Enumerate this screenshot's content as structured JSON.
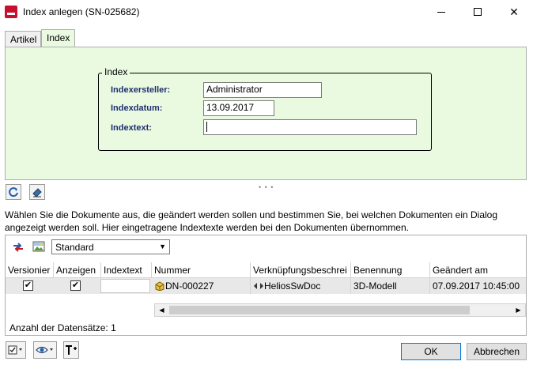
{
  "window": {
    "title": "Index anlegen (SN-025682)",
    "minimize": "—",
    "maximize": "",
    "close": "✕"
  },
  "tabs": [
    {
      "label": "Artikel",
      "active": false
    },
    {
      "label": "Index",
      "active": true
    }
  ],
  "index_group": {
    "legend": "Index",
    "creator_label": "Indexersteller:",
    "creator_value": "Administrator",
    "date_label": "Indexdatum:",
    "date_value": "13.09.2017",
    "text_label": "Indextext:",
    "text_value": ""
  },
  "splitter": "• • •",
  "description": "Wählen Sie die Dokumente aus, die geändert werden sollen und bestimmen Sie, bei welchen Dokumenten ein Dialog angezeigt werden soll. Hier eingetragene Indextexte werden bei den Dokumenten übernommen.",
  "grid": {
    "view_select": "Standard",
    "columns": [
      "Versionier",
      "Anzeigen",
      "Indextext",
      "Nummer",
      "Verknüpfungsbeschrei",
      "Benennung",
      "Geändert am"
    ],
    "rows": [
      {
        "versionieren": "✔",
        "anzeigen": "✔",
        "indextext": "",
        "nummer": "DN-000227",
        "verknuepfung": "HeliosSwDoc",
        "benennung": "3D-Modell",
        "geaendert": "07.09.2017 10:45:00"
      }
    ],
    "count_label": "Anzahl der Datensätze: 1"
  },
  "buttons": {
    "ok": "OK",
    "cancel": "Abbrechen"
  },
  "colors": {
    "panel_bg": "#eafae1",
    "label_color": "#1f2d6e",
    "accent_border": "#0078d7"
  }
}
